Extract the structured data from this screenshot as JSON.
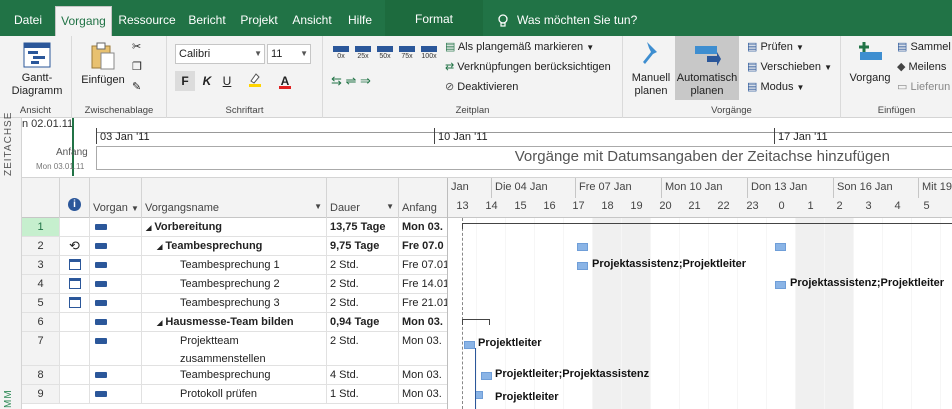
{
  "tabs": [
    {
      "label": "Datei",
      "active": false
    },
    {
      "label": "Vorgang",
      "active": true
    },
    {
      "label": "Ressource",
      "active": false
    },
    {
      "label": "Bericht",
      "active": false
    },
    {
      "label": "Projekt",
      "active": false
    },
    {
      "label": "Ansicht",
      "active": false
    },
    {
      "label": "Hilfe",
      "active": false
    }
  ],
  "context_tab": "Format",
  "tell_me": "Was möchten Sie tun?",
  "ribbon": {
    "ansicht": {
      "button": "Gantt-",
      "button2": "Diagramm",
      "label": "Ansicht"
    },
    "zwischenablage": {
      "button": "Einfügen",
      "label": "Zwischenablage"
    },
    "schriftart": {
      "font": "Calibri",
      "size": "11",
      "bold": "F",
      "italic": "K",
      "underline": "U",
      "label": "Schriftart"
    },
    "zeitplan": {
      "pct": [
        "0x",
        "25x",
        "50x",
        "75x",
        "100x"
      ],
      "mark": "Als plangemäß markieren",
      "links": "Verknüpfungen berücksichtigen",
      "deactivate": "Deaktivieren",
      "label": "Zeitplan"
    },
    "vorgaenge": {
      "manual": "Manuell",
      "manual2": "planen",
      "auto": "Automatisch",
      "auto2": "planen",
      "check": "Prüfen",
      "move": "Verschieben",
      "mode": "Modus",
      "label": "Vorgänge"
    },
    "einfuegen": {
      "button": "Vorgang",
      "summary": "Sammel",
      "milestone": "Meilens",
      "deliver": "Lieferun",
      "label": "Einfügen"
    }
  },
  "timeline": {
    "side_label": "ZEITACHSE",
    "left_date": "n 02.01.11",
    "start_label": "Anfang",
    "start_date": "Mon 03.01.11",
    "ticks": [
      "03 Jan '11",
      "10 Jan '11",
      "17 Jan '11"
    ],
    "placeholder": "Vorgänge mit Datumsangaben der Zeitachse hinzufügen"
  },
  "sheet": {
    "side_label": "MM",
    "columns": [
      "",
      "Vorgan",
      "Vorgangsname",
      "Dauer",
      "Anfang"
    ],
    "rows": [
      {
        "num": "1",
        "mode": "auto",
        "name": "Vorbereitung",
        "indent": 0,
        "summary": true,
        "dur": "13,75 Tage",
        "start": "Mon 03.",
        "selected": true
      },
      {
        "num": "2",
        "mode": "auto",
        "info": "recurring",
        "name": "Teambesprechung",
        "indent": 1,
        "summary": true,
        "dur": "9,75 Tage",
        "start": "Fre 07.0"
      },
      {
        "num": "3",
        "mode": "auto",
        "info": "calendar",
        "name": "Teambesprechung  1",
        "indent": 2,
        "summary": false,
        "dur": "2 Std.",
        "start": "Fre 07.01"
      },
      {
        "num": "4",
        "mode": "auto",
        "info": "calendar",
        "name": "Teambesprechung  2",
        "indent": 2,
        "summary": false,
        "dur": "2 Std.",
        "start": "Fre 14.01"
      },
      {
        "num": "5",
        "mode": "auto",
        "info": "calendar",
        "name": "Teambesprechung  3",
        "indent": 2,
        "summary": false,
        "dur": "2 Std.",
        "start": "Fre 21.01"
      },
      {
        "num": "6",
        "mode": "auto",
        "name": "Hausmesse-Team bilden",
        "indent": 1,
        "summary": true,
        "dur": "0,94 Tage",
        "start": "Mon 03."
      },
      {
        "num": "7",
        "mode": "auto",
        "name": "Projektteam",
        "name2": "zusammenstellen",
        "indent": 2,
        "summary": false,
        "dur": "2 Std.",
        "start": "Mon 03."
      },
      {
        "num": "8",
        "mode": "auto",
        "name": "Teambesprechung",
        "indent": 2,
        "summary": false,
        "dur": "4 Std.",
        "start": "Mon 03."
      },
      {
        "num": "9",
        "mode": "auto",
        "name": "Protokoll prüfen",
        "indent": 2,
        "summary": false,
        "dur": "1 Std.",
        "start": "Mon 03."
      }
    ]
  },
  "gantt": {
    "weeks": [
      "Jan",
      "Die 04 Jan",
      "Fre 07 Jan",
      "Mon 10 Jan",
      "Don 13 Jan",
      "Son 16 Jan",
      "Mit 19"
    ],
    "days": [
      "13",
      "14",
      "15",
      "16",
      "17",
      "18",
      "19",
      "20",
      "21",
      "22",
      "23",
      "0",
      "1",
      "2",
      "3",
      "4",
      "5"
    ],
    "resources": {
      "r3": "Projektassistenz;Projektleiter",
      "r4": "Projektassistenz;Projektleiter",
      "r7": "Projektleiter",
      "r8": "Projektleiter;Projektassistenz",
      "r9": "Projektleiter"
    }
  },
  "colors": {
    "accent": "#217346",
    "bar": "#8ab4e6",
    "selected": "#c6efce"
  }
}
